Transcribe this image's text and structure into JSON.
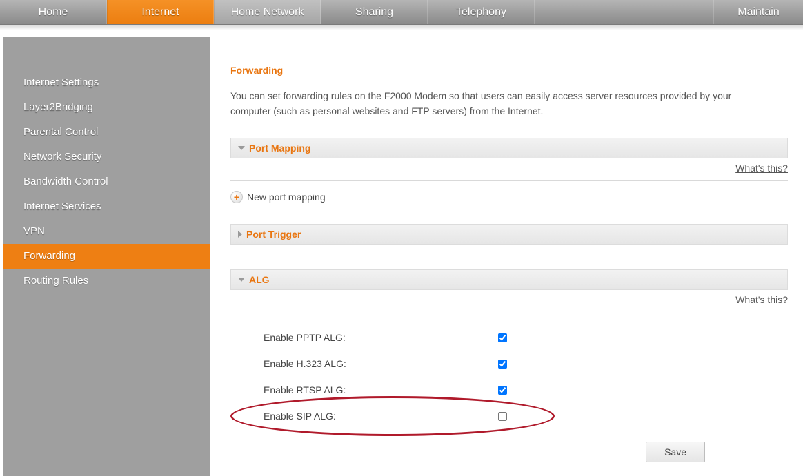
{
  "topnav": {
    "items": [
      {
        "label": "Home"
      },
      {
        "label": "Internet"
      },
      {
        "label": "Home Network"
      },
      {
        "label": "Sharing"
      },
      {
        "label": "Telephony"
      }
    ],
    "active_index": 1,
    "maintain_label": "Maintain"
  },
  "sidebar": {
    "items": [
      {
        "label": "Internet Settings"
      },
      {
        "label": "Layer2Bridging"
      },
      {
        "label": "Parental Control"
      },
      {
        "label": "Network Security"
      },
      {
        "label": "Bandwidth Control"
      },
      {
        "label": "Internet Services"
      },
      {
        "label": "VPN"
      },
      {
        "label": "Forwarding"
      },
      {
        "label": "Routing Rules"
      }
    ],
    "active_index": 7
  },
  "page": {
    "title": "Forwarding",
    "description": "You can set forwarding rules on the F2000 Modem so that users can easily access server resources provided by your computer (such as personal websites and FTP servers) from the Internet."
  },
  "sections": {
    "port_mapping": {
      "label": "Port Mapping",
      "expanded": true,
      "whats_this": "What's this?",
      "new_label": "New port mapping"
    },
    "port_trigger": {
      "label": "Port Trigger",
      "expanded": false
    },
    "alg": {
      "label": "ALG",
      "expanded": true,
      "whats_this": "What's this?",
      "rows": [
        {
          "label": "Enable PPTP ALG:",
          "checked": true
        },
        {
          "label": "Enable H.323 ALG:",
          "checked": true
        },
        {
          "label": "Enable RTSP ALG:",
          "checked": true
        },
        {
          "label": "Enable SIP ALG:",
          "checked": false
        }
      ]
    }
  },
  "buttons": {
    "save": "Save"
  },
  "annotation": {
    "highlight_row_index": 3
  }
}
